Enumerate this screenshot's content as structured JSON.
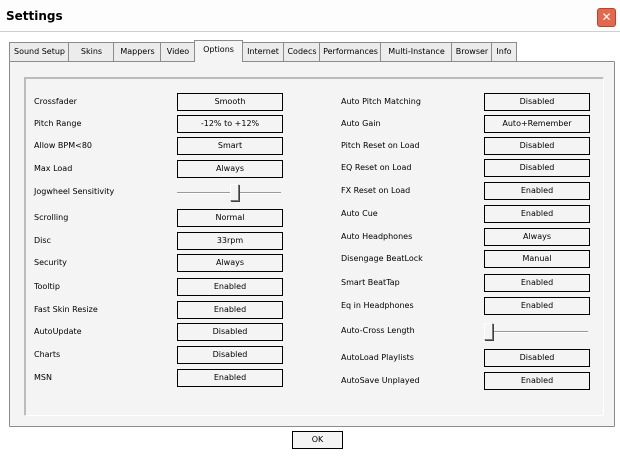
{
  "window": {
    "title": "Settings",
    "close_symbol": "✕"
  },
  "tabs": [
    "Sound Setup",
    "Skins",
    "Mappers",
    "Video",
    "Options",
    "Internet",
    "Codecs",
    "Performances",
    "Multi-Instance",
    "Browser",
    "Info"
  ],
  "active_tab": "Options",
  "left_settings": [
    {
      "label": "Crossfader",
      "value": "Smooth"
    },
    {
      "label": "Pitch Range",
      "value": "-12% to +12%"
    },
    {
      "label": "Allow BPM<80",
      "value": "Smart"
    },
    {
      "label": "Max Load",
      "value": "Always"
    },
    {
      "label": "Jogwheel Sensitivity",
      "slider": 0.55
    },
    {
      "label": "Scrolling",
      "value": "Normal"
    },
    {
      "label": "Disc",
      "value": "33rpm"
    },
    {
      "label": "Security",
      "value": "Always"
    },
    {
      "label": "Tooltip",
      "value": "Enabled"
    },
    {
      "label": "Fast Skin Resize",
      "value": "Enabled"
    },
    {
      "label": "AutoUpdate",
      "value": "Disabled"
    },
    {
      "label": "Charts",
      "value": "Disabled"
    },
    {
      "label": "MSN",
      "value": "Enabled"
    }
  ],
  "right_settings": [
    {
      "label": "Auto Pitch Matching",
      "value": "Disabled"
    },
    {
      "label": "Auto Gain",
      "value": "Auto+Remember"
    },
    {
      "label": "Pitch Reset on Load",
      "value": "Disabled"
    },
    {
      "label": "EQ Reset on Load",
      "value": "Disabled"
    },
    {
      "label": "FX Reset on Load",
      "value": "Enabled"
    },
    {
      "label": "Auto Cue",
      "value": "Enabled"
    },
    {
      "label": "Auto Headphones",
      "value": "Always"
    },
    {
      "label": "Disengage BeatLock",
      "value": "Manual"
    },
    {
      "label": "Smart BeatTap",
      "value": "Enabled"
    },
    {
      "label": "Eq in Headphones",
      "value": "Enabled"
    },
    {
      "label": "Auto-Cross Length",
      "slider": 0.0
    },
    {
      "label": "AutoLoad Playlists",
      "value": "Disabled"
    },
    {
      "label": "AutoSave Unplayed",
      "value": "Enabled"
    }
  ],
  "ok_label": "OK"
}
